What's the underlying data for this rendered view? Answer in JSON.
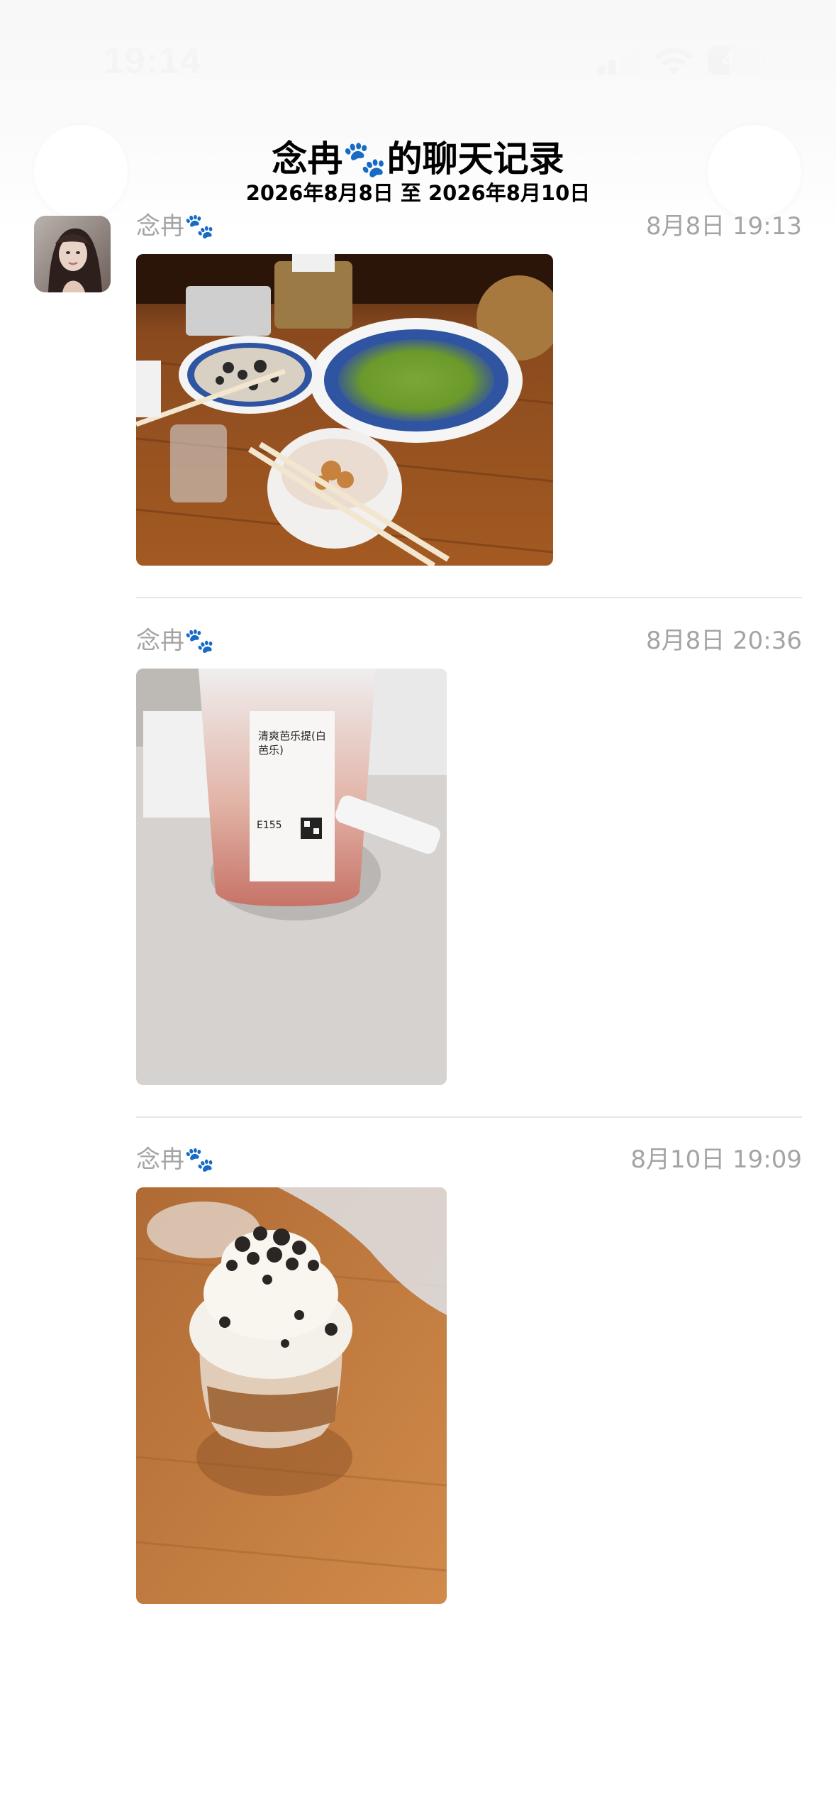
{
  "status_bar": {
    "time": "19:14",
    "battery_level": "42",
    "battery_fraction": 0.42,
    "signal_bars_active": 2,
    "signal_bars_total": 4
  },
  "header": {
    "title_name": "念冉",
    "title_suffix": "的聊天记录",
    "title_emoji": "🐾",
    "subtitle": "2026年8月8日 至 2026年8月10日"
  },
  "messages": [
    {
      "sender": "念冉🐾",
      "time": "8月8日 19:13",
      "photo": "restaurant-table-photo"
    },
    {
      "sender": "念冉🐾",
      "time": "8月8日 20:36",
      "photo": "fruit-tea-cup-photo",
      "cup_label_line1": "清爽芭乐提(白",
      "cup_label_line2": "芭乐)",
      "cup_code": "E155"
    },
    {
      "sender": "念冉🐾",
      "time": "8月10日 19:09",
      "photo": "oreo-cream-dessert-photo"
    }
  ],
  "colors": {
    "meta_text": "#a4a4a4",
    "divider": "#e6e6e6",
    "background": "#ffffff"
  }
}
